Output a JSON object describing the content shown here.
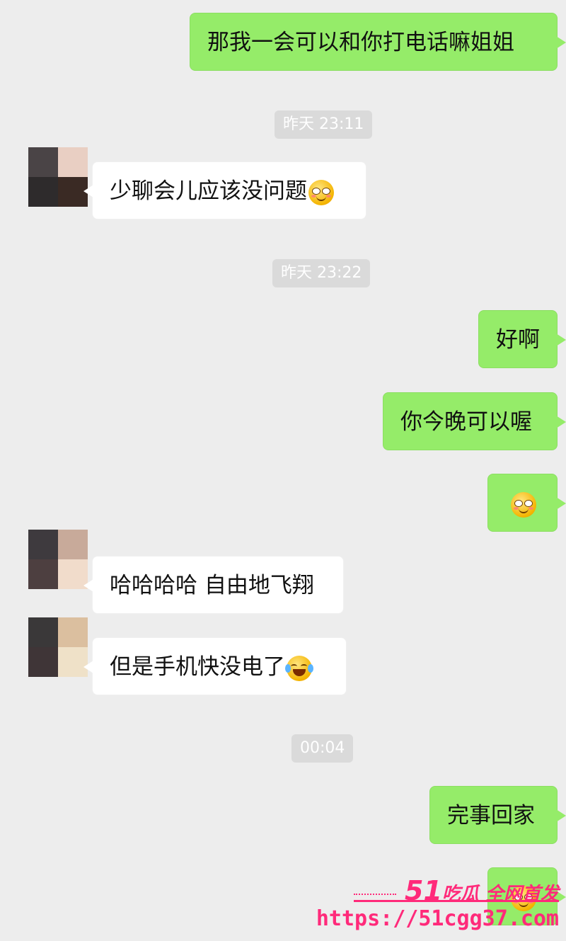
{
  "messages": [
    {
      "text": "那我一会可以和你打电话嘛姐姐"
    },
    {
      "text": "少聊会儿应该没问题",
      "emoji": "blush-smile-icon"
    },
    {
      "text": "好啊"
    },
    {
      "text": "你今晚可以喔"
    },
    {
      "emoji": "blush-smile-icon"
    },
    {
      "text": "哈哈哈哈 自由地飞翔"
    },
    {
      "text": "但是手机快没电了",
      "emoji": "tears-of-joy-icon"
    },
    {
      "text": "完事回家"
    },
    {
      "emoji": "blush-smile-icon"
    }
  ],
  "timestamps": [
    "昨天 23:11",
    "昨天 23:22",
    "00:04"
  ],
  "watermark": {
    "brand_num": "51",
    "brand_text": "吃瓜",
    "slogan": "全网首发",
    "url": "https://51cgg37.com"
  },
  "colors": {
    "background": "#ededed",
    "outgoing_bubble": "#95ec69",
    "incoming_bubble": "#ffffff",
    "timestamp_bg": "#dadada",
    "watermark": "#ff2a7a"
  }
}
